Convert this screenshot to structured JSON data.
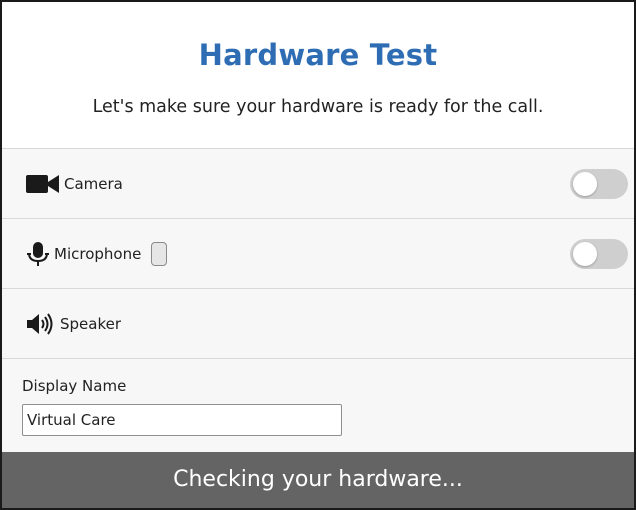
{
  "header": {
    "title": "Hardware Test",
    "subtitle": "Let's make sure your hardware is ready for the call."
  },
  "devices": {
    "camera": {
      "label": "Camera",
      "icon": "video-camera-icon",
      "toggle_on": false
    },
    "microphone": {
      "label": "Microphone",
      "icon": "microphone-icon",
      "toggle_on": false,
      "level": 0
    },
    "speaker": {
      "label": "Speaker",
      "icon": "speaker-icon"
    }
  },
  "display_name": {
    "label": "Display Name",
    "value": "Virtual Care"
  },
  "status": {
    "text": "Checking your hardware..."
  },
  "colors": {
    "title": "#2e6db4",
    "footer_bg": "#646464",
    "toggle_off": "#cfcfcf",
    "row_bg": "#f7f7f7"
  }
}
